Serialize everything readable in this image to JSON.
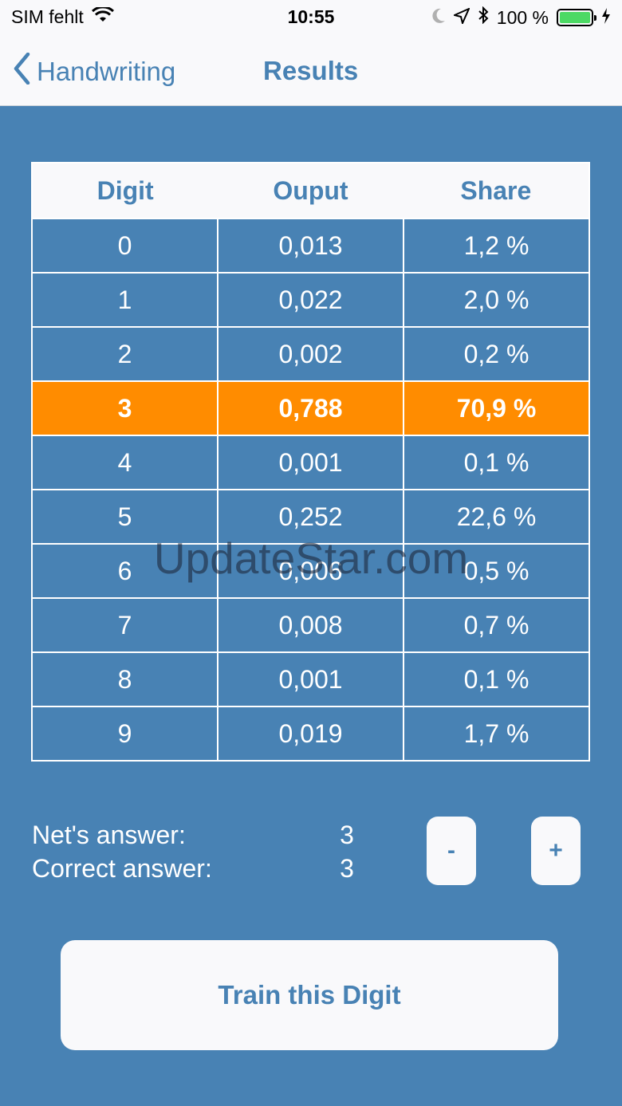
{
  "status_bar": {
    "carrier": "SIM fehlt",
    "time": "10:55",
    "battery": "100 %",
    "icons": [
      "wifi-icon",
      "moon-icon",
      "location-icon",
      "bluetooth-icon",
      "battery-icon",
      "charging-icon"
    ]
  },
  "nav": {
    "back_label": "Handwriting",
    "title": "Results"
  },
  "table": {
    "headers": [
      "Digit",
      "Ouput",
      "Share"
    ],
    "rows": [
      {
        "digit": "0",
        "output": "0,013",
        "share": "1,2 %"
      },
      {
        "digit": "1",
        "output": "0,022",
        "share": "2,0 %"
      },
      {
        "digit": "2",
        "output": "0,002",
        "share": "0,2 %"
      },
      {
        "digit": "3",
        "output": "0,788",
        "share": "70,9 %"
      },
      {
        "digit": "4",
        "output": "0,001",
        "share": "0,1 %"
      },
      {
        "digit": "5",
        "output": "0,252",
        "share": "22,6 %"
      },
      {
        "digit": "6",
        "output": "0,006",
        "share": "0,5 %"
      },
      {
        "digit": "7",
        "output": "0,008",
        "share": "0,7 %"
      },
      {
        "digit": "8",
        "output": "0,001",
        "share": "0,1 %"
      },
      {
        "digit": "9",
        "output": "0,019",
        "share": "1,7 %"
      }
    ],
    "highlight_color": "#ff8c00"
  },
  "answers": {
    "net_label": "Net's answer:",
    "net_value": "3",
    "correct_label": "Correct answer:",
    "correct_value": "3"
  },
  "controls": {
    "minus_label": "-",
    "plus_label": "+",
    "train_label": "Train this Digit"
  },
  "watermark": "UpdateStar.com",
  "colors": {
    "accent": "#4882b4",
    "background": "#4882b4",
    "bar": "#f9f9fb"
  }
}
